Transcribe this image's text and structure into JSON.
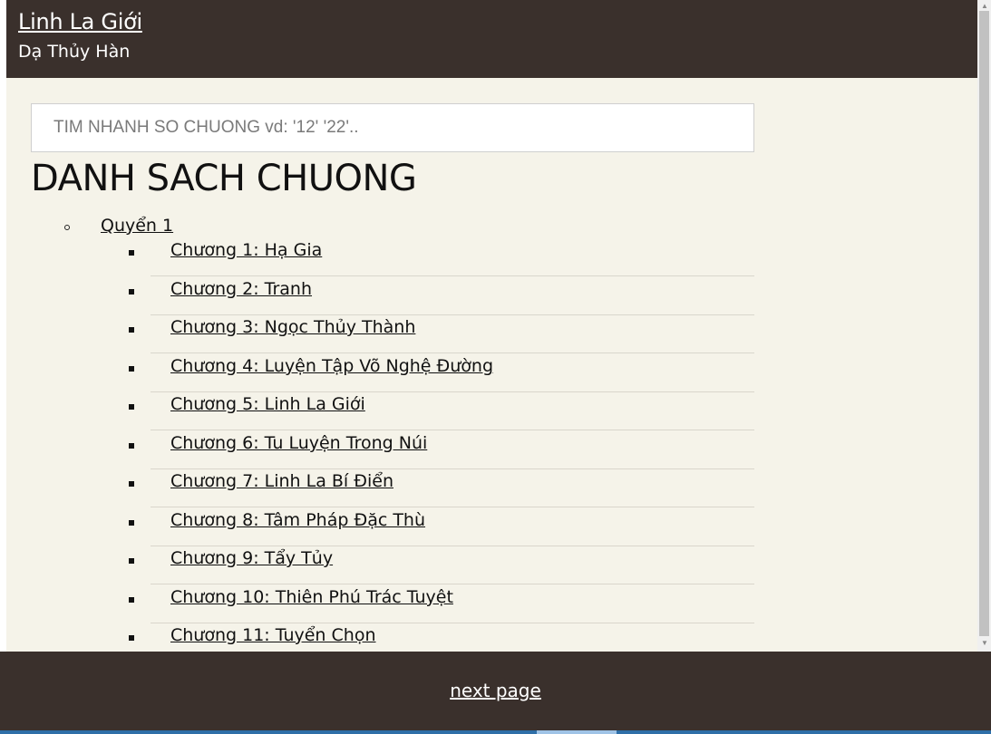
{
  "header": {
    "title": "Linh La Giới",
    "author": "Dạ Thủy Hàn"
  },
  "search": {
    "placeholder": "TIM NHANH SO CHUONG vd: '12' '22'.."
  },
  "heading": "DANH SACH CHUONG",
  "volume": {
    "label": "Quyển 1"
  },
  "chapters": [
    "Chương 1: Hạ Gia",
    "Chương 2: Tranh",
    "Chương 3: Ngọc Thủy Thành",
    "Chương 4: Luyện Tập Võ Nghệ Đường",
    "Chương 5: Linh La Giới",
    "Chương 6: Tu Luyện Trong Núi",
    "Chương 7: Linh La Bí Điển",
    "Chương 8: Tâm Pháp Đặc Thù",
    "Chương 9: Tẩy Tủy",
    "Chương 10: Thiên Phú Trác Tuyệt",
    "Chương 11: Tuyển Chọn"
  ],
  "footer": {
    "next_label": "next page"
  },
  "colors": {
    "header_bg": "#3a302c",
    "page_bg": "#f5f3e9"
  }
}
